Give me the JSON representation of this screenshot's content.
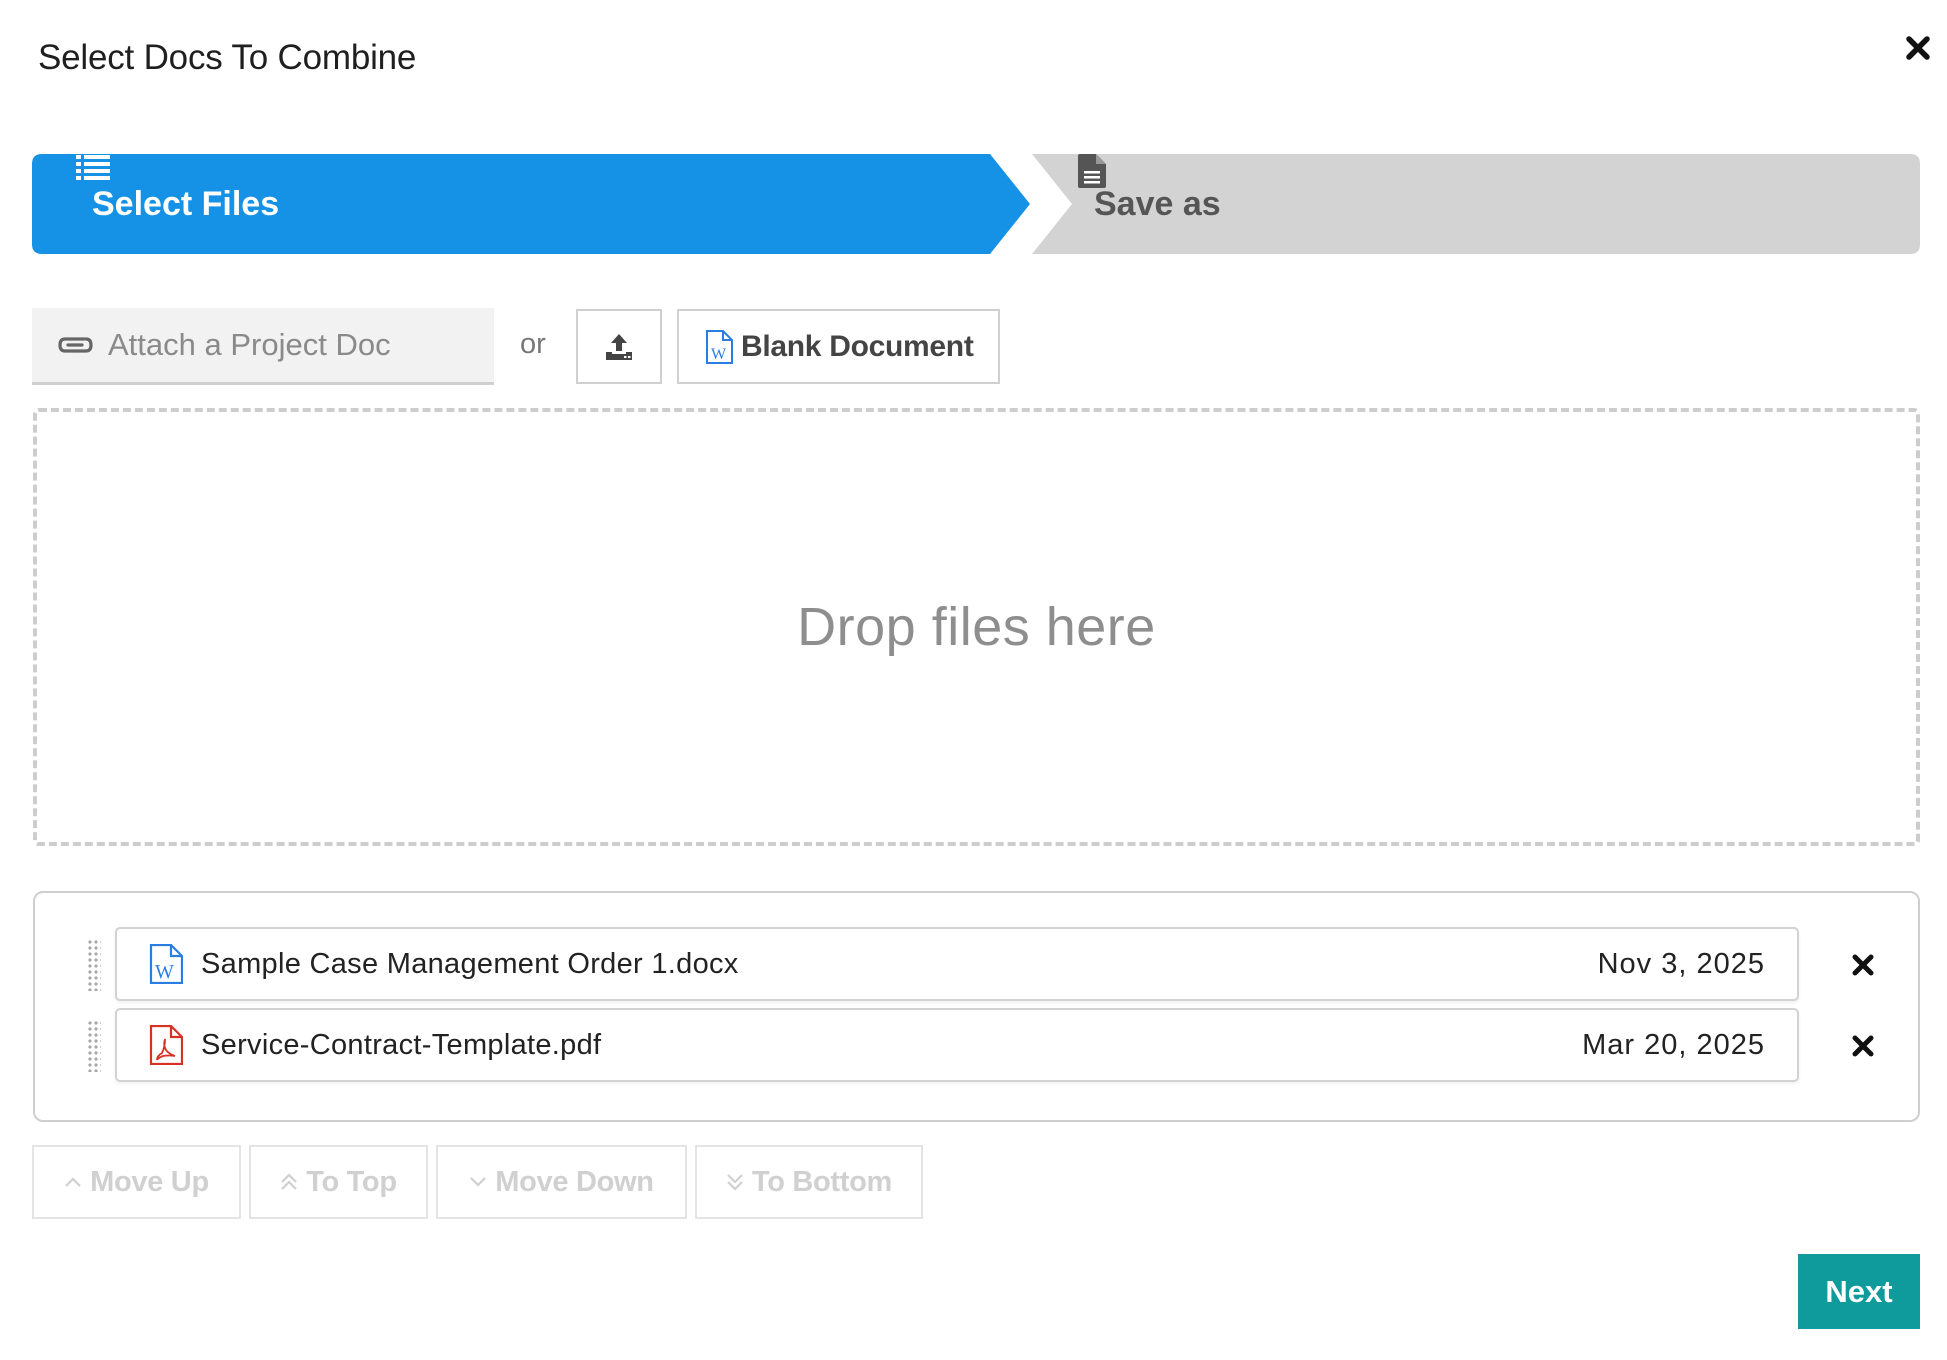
{
  "dialog": {
    "title": "Select Docs To Combine",
    "close_icon": "close-icon"
  },
  "stepper": {
    "active_color": "#1592e6",
    "inactive_color": "#d3d3d3",
    "steps": [
      {
        "label": "Select Files",
        "icon": "list-icon",
        "active": true
      },
      {
        "label": "Save as",
        "icon": "document-icon",
        "active": false
      }
    ]
  },
  "actions": {
    "attach_placeholder": "Attach a Project Doc",
    "attach_icon": "paperclip-icon",
    "or_text": "or",
    "upload_icon": "upload-icon",
    "blank_document_label": "Blank Document",
    "blank_document_icon": "word-file-icon"
  },
  "dropzone": {
    "text": "Drop files here"
  },
  "files": [
    {
      "name": "Sample Case Management Order 1.docx",
      "date": "Nov 3, 2025",
      "type": "word",
      "icon": "word-file-icon"
    },
    {
      "name": "Service-Contract-Template.pdf",
      "date": "Mar 20, 2025",
      "type": "pdf",
      "icon": "pdf-file-icon"
    }
  ],
  "move_buttons": {
    "move_up": "Move Up",
    "to_top": "To Top",
    "move_down": "Move Down",
    "to_bottom": "To Bottom"
  },
  "footer": {
    "next_label": "Next",
    "next_color": "#0f9b9b"
  }
}
